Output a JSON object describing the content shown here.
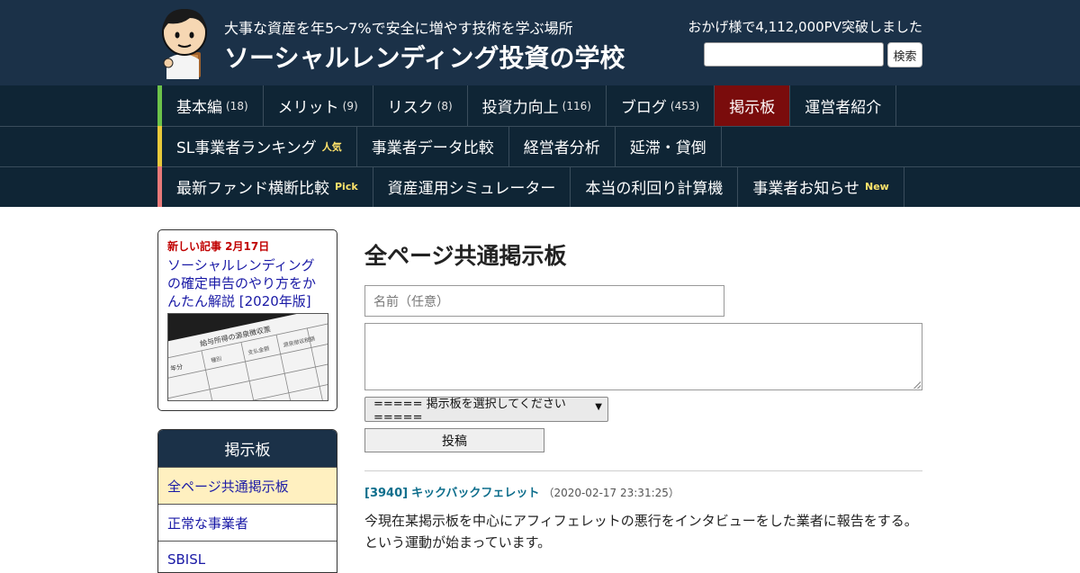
{
  "header": {
    "tagline": "大事な資産を年5～7%で安全に増やす技術を学ぶ場所",
    "site_title": "ソーシャルレンディング投資の学校",
    "pv_text": "おかげ様で4,112,000PV突破しました",
    "search_button": "検索",
    "search_value": ""
  },
  "nav": {
    "row1": [
      {
        "label": "基本編",
        "count": "(18)"
      },
      {
        "label": "メリット",
        "count": "(9)"
      },
      {
        "label": "リスク",
        "count": "(8)"
      },
      {
        "label": "投資力向上",
        "count": "(116)"
      },
      {
        "label": "ブログ",
        "count": "(453)"
      },
      {
        "label": "掲示板",
        "active": true
      },
      {
        "label": "運営者紹介"
      }
    ],
    "row2": [
      {
        "label": "SL事業者ランキング",
        "tag": "人気"
      },
      {
        "label": "事業者データ比較"
      },
      {
        "label": "経営者分析"
      },
      {
        "label": "延滞・貸倒"
      }
    ],
    "row3": [
      {
        "label": "最新ファンド横断比較",
        "tag": "Pick"
      },
      {
        "label": "資産運用シミュレーター"
      },
      {
        "label": "本当の利回り計算機"
      },
      {
        "label": "事業者お知らせ",
        "tag": "New"
      }
    ]
  },
  "sidebar": {
    "new_article_label": "新しい記事 2月17日",
    "new_article_link": "ソーシャルレンディングの確定申告のやり方をかんたん解説 [2020年版]",
    "board_heading": "掲示板",
    "board_items": [
      "全ページ共通掲示板",
      "正常な事業者",
      "SBISL"
    ],
    "thumb_texts": {
      "t1": "給与所得の源泉徴収票",
      "t2": "年分",
      "t3": "種別",
      "t4": "金額",
      "t5": "支払金額",
      "t6": "源泉徴収税額"
    }
  },
  "main": {
    "title": "全ページ共通掲示板",
    "name_placeholder": "名前（任意）",
    "select_value": "===== 掲示板を選択してください =====",
    "post_button": "投稿",
    "post": {
      "id": "[3940]",
      "author": "キックバックフェレット",
      "date": "（2020-02-17 23:31:25）",
      "body_line1": "今現在某掲示板を中心にアフィフェレットの悪行をインタビューをした業者に報告をする。",
      "body_line2": "という運動が始まっています。"
    }
  },
  "colors": {
    "header_bg": "#1b3148",
    "nav_bg": "#0f2535",
    "nav_active": "#7a0c0c",
    "row1_accent": "#6cc24a",
    "row2_accent": "#e8c93a",
    "row3_accent": "#e87979",
    "new_label": "#c00000",
    "link": "#1a1aa6",
    "post_author": "#0e6e8c"
  }
}
